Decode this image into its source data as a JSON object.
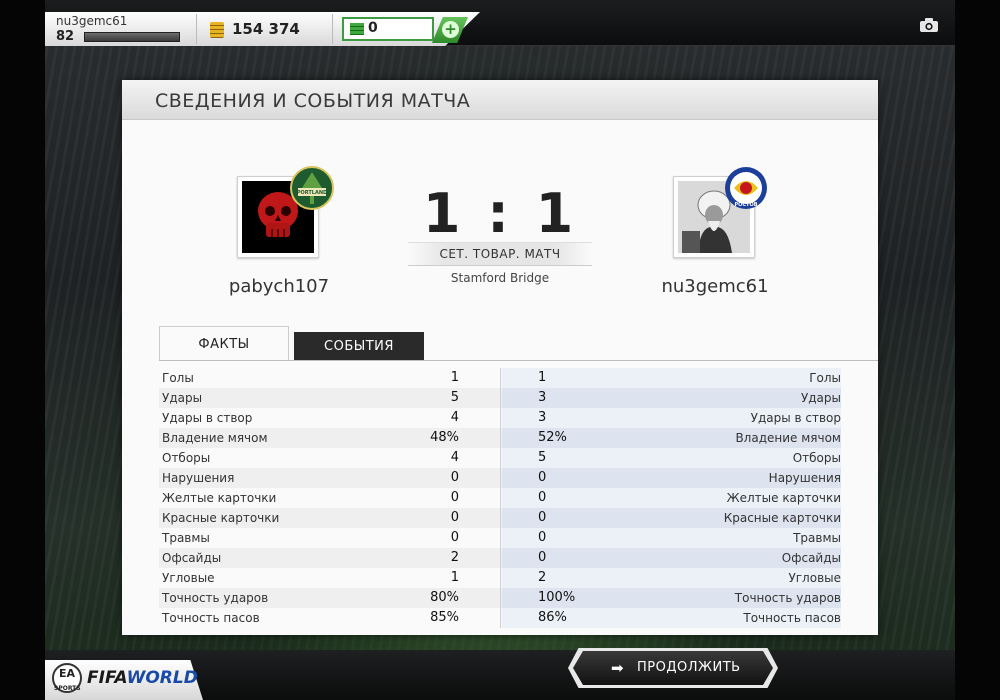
{
  "topbar": {
    "username": "nu3gemc61",
    "level": "82",
    "coins": "154 374",
    "points": "0",
    "plus_label": "+"
  },
  "panel": {
    "title": "СВЕДЕНИЯ И СОБЫТИЯ МАТЧА",
    "score": "1 : 1",
    "match_type": "СЕТ. ТОВАР. МАТЧ",
    "stadium": "Stamford Bridge",
    "home": {
      "name": "pabych107",
      "crest_text": "PORTLAND TIMBERS"
    },
    "away": {
      "name": "nu3gemc61",
      "crest_text": "РОСТОВ"
    }
  },
  "tabs": {
    "facts": "ФАКТЫ",
    "events": "СОБЫТИЯ"
  },
  "stats": [
    {
      "label": "Голы",
      "home": "1",
      "away": "1"
    },
    {
      "label": "Удары",
      "home": "5",
      "away": "3"
    },
    {
      "label": "Удары в створ",
      "home": "4",
      "away": "3"
    },
    {
      "label": "Владение мячом",
      "home": "48%",
      "away": "52%"
    },
    {
      "label": "Отборы",
      "home": "4",
      "away": "5"
    },
    {
      "label": "Нарушения",
      "home": "0",
      "away": "0"
    },
    {
      "label": "Желтые карточки",
      "home": "0",
      "away": "0"
    },
    {
      "label": "Красные карточки",
      "home": "0",
      "away": "0"
    },
    {
      "label": "Травмы",
      "home": "0",
      "away": "0"
    },
    {
      "label": "Офсайды",
      "home": "2",
      "away": "0"
    },
    {
      "label": "Угловые",
      "home": "1",
      "away": "2"
    },
    {
      "label": "Точность ударов",
      "home": "80%",
      "away": "100%"
    },
    {
      "label": "Точность пасов",
      "home": "85%",
      "away": "86%"
    }
  ],
  "footer": {
    "ea_label": "EA SPORTS",
    "fifa_label": "FIFA",
    "world_label": "WORLD",
    "continue_label": "ПРОДОЛЖИТЬ",
    "continue_arrow": "➡"
  },
  "colors": {
    "accent_green": "#3f9a44",
    "dark": "#2a2a2a",
    "panel_bg": "#fafafa"
  },
  "progress": {
    "xp_fraction": 0.0
  }
}
